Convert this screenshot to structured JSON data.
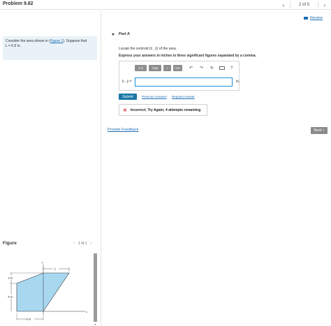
{
  "header": {
    "title": "Problem 9.82",
    "prev_icon": "chevron-left-icon",
    "page_text": "2 of 5",
    "next_icon": "chevron-right-icon"
  },
  "prompt": {
    "before_link": "Consider the area shown in (",
    "link": "Figure 1",
    "after_link": "). Suppose that",
    "line2": "L = 6.9 in."
  },
  "figure": {
    "label": "Figure",
    "pager_text": "1 of 1",
    "dims": {
      "height_top": "3 in.",
      "height_bottom": "6 in.",
      "width_bottom": "6 in.",
      "L": "L",
      "x_axis": "x",
      "y_axis": "y"
    }
  },
  "review": {
    "label": "Review"
  },
  "part": {
    "title": "Part A",
    "question": "Locate the centroid (x̄ , ȳ) of the area.",
    "instruction": "Express your answers in inches to three significant figures separated by a comma."
  },
  "answer": {
    "toolbar": {
      "templates_label": "▯√▯",
      "greek_label": "ΑΣφ",
      "vector_label": "↕",
      "vec_label": "vec",
      "undo_icon": "undo-icon",
      "redo_icon": "redo-icon",
      "reset_icon": "reset-icon",
      "keyboard_icon": "keyboard-icon",
      "help_icon": "help-icon",
      "help_glyph": "?"
    },
    "field_label": "x̄ , ȳ =",
    "value": "",
    "unit": "in."
  },
  "actions": {
    "submit": "Submit",
    "previous_answers": "Previous Answers",
    "request_answer": "Request Answer"
  },
  "feedback": {
    "icon": "x-icon",
    "text": "Incorrect; Try Again; 4 attempts remaining"
  },
  "footer": {
    "provide_feedback": "Provide Feedback",
    "next": "Next"
  },
  "colors": {
    "link": "#1a6fb5",
    "submit": "#1a78a8",
    "error": "#d4202c",
    "shape_fill": "#a8d8f0"
  }
}
